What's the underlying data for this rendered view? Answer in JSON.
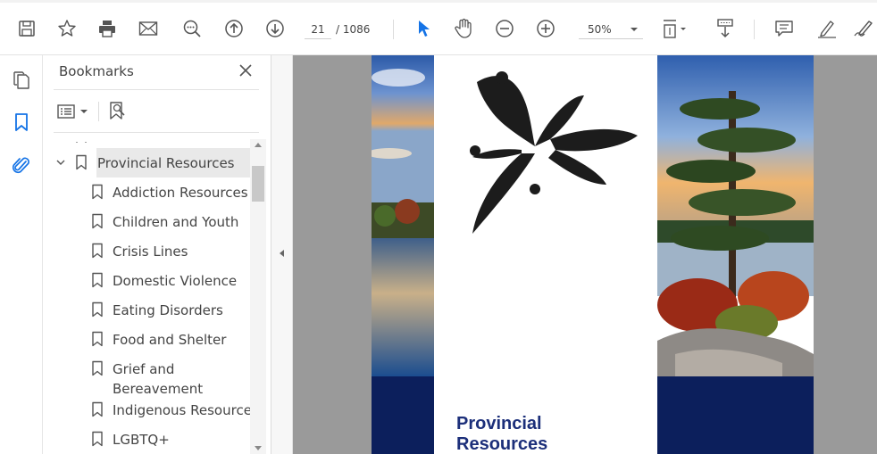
{
  "toolbar": {
    "page_current": "21",
    "page_total": "/ 1086",
    "zoom": "50%",
    "icons": [
      "save-icon",
      "bookmark-star-icon",
      "print-icon",
      "email-icon",
      "zoom-search-icon",
      "page-up-icon",
      "page-down-icon",
      "select-arrow-icon",
      "hand-icon",
      "zoom-out-icon",
      "zoom-in-icon",
      "fit-page-icon",
      "scroll-mode-icon",
      "comment-icon",
      "highlight-icon",
      "sign-icon"
    ],
    "accent": "#1473e6"
  },
  "rail": {
    "icons": [
      "pages-icon",
      "bookmarks-icon",
      "attachment-icon"
    ]
  },
  "bookmarks": {
    "title": "Bookmarks",
    "parent": "Provincial Resources",
    "items": [
      "Addiction Resources",
      "Children and Youth",
      "Crisis Lines",
      "Domestic Violence",
      "Eating Disorders",
      "Food and Shelter",
      "Grief and",
      "Bereavement",
      "Indigenous Resources",
      "LGBTQ+"
    ]
  },
  "document": {
    "cover_title_line1": "Provincial",
    "cover_title_line2": "Resources",
    "navy": "#0c1f5c",
    "title_color": "#1c2f7a"
  }
}
